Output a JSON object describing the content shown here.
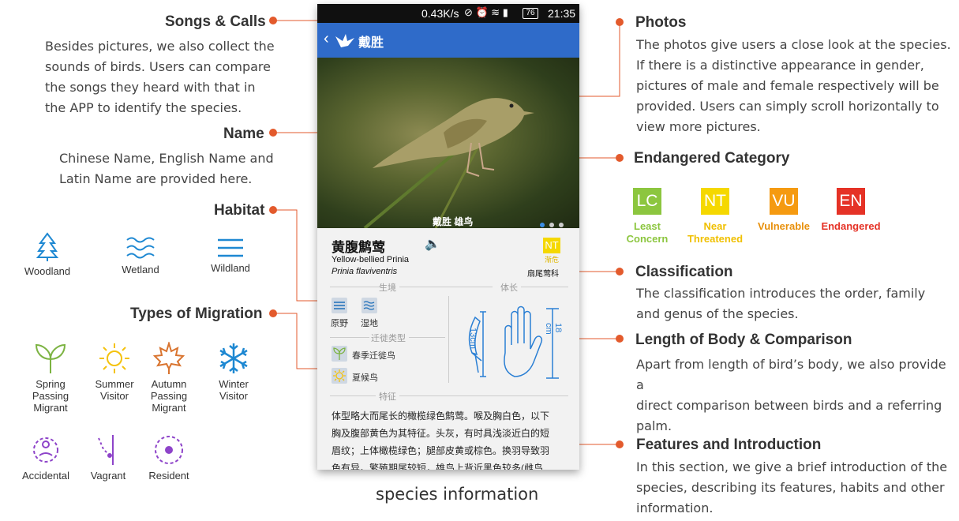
{
  "caption": "species information",
  "left": {
    "songs": {
      "title": "Songs & Calls",
      "lines": [
        "Besides pictures, we also collect the",
        "sounds of birds. Users can compare",
        "the songs they heard with that in",
        "the APP to identify the species."
      ]
    },
    "name": {
      "title": "Name",
      "lines": [
        "Chinese Name, English Name and",
        "Latin Name are provided here."
      ]
    },
    "habitat": {
      "title": "Habitat",
      "items": [
        {
          "label": "Woodland",
          "icon": "tree-icon"
        },
        {
          "label": "Wetland",
          "icon": "waves-icon"
        },
        {
          "label": "Wildland",
          "icon": "lines-icon"
        }
      ]
    },
    "migration": {
      "title": "Types of Migration",
      "items": [
        {
          "label": [
            "Spring",
            "Passing",
            "Migrant"
          ],
          "icon": "sprout-icon",
          "color": "#7cb342"
        },
        {
          "label": [
            "Summer",
            "Visitor"
          ],
          "icon": "sun-icon",
          "color": "#f4c20d"
        },
        {
          "label": [
            "Autumn",
            "Passing",
            "Migrant"
          ],
          "icon": "maple-leaf-icon",
          "color": "#d9742f"
        },
        {
          "label": [
            "Winter",
            "Visitor"
          ],
          "icon": "snowflake-icon",
          "color": "#1e88d2"
        },
        {
          "label": [
            "Accidental"
          ],
          "icon": "accidental-icon",
          "color": "#8e44c9"
        },
        {
          "label": [
            "Vagrant"
          ],
          "icon": "vagrant-icon",
          "color": "#8e44c9"
        },
        {
          "label": [
            "Resident"
          ],
          "icon": "resident-icon",
          "color": "#8e44c9"
        }
      ]
    }
  },
  "right": {
    "photos": {
      "title": "Photos",
      "lines": [
        "The photos give users a close look at the species.",
        "If there is a distinctive appearance in gender,",
        "pictures of male and female respectively will be",
        "provided. Users can simply scroll horizontally to",
        "view more pictures."
      ]
    },
    "endangered": {
      "title": "Endangered Category",
      "badges": [
        {
          "code": "LC",
          "label": [
            "Least",
            "Concern"
          ],
          "color": "#8cc63f"
        },
        {
          "code": "NT",
          "label": [
            "Near",
            "Threatened"
          ],
          "color": "#f5d800"
        },
        {
          "code": "VU",
          "label": [
            "Vulnerable"
          ],
          "color": "#f59a10"
        },
        {
          "code": "EN",
          "label": [
            "Endangered"
          ],
          "color": "#e53226"
        }
      ]
    },
    "classification": {
      "title": "Classification",
      "lines": [
        "The classification introduces the order, family",
        "and genus of the species."
      ]
    },
    "length": {
      "title": "Length of Body & Comparison",
      "lines": [
        "Apart from length of bird’s body, we also provide a",
        "direct comparison between birds and a referring",
        "palm."
      ]
    },
    "features": {
      "title": "Features and Introduction",
      "lines": [
        "In this section, we give a brief introduction of the",
        "species, describing its features, habits and other",
        "information."
      ]
    }
  },
  "phone": {
    "status": {
      "speed": "0.43K/s",
      "battery": "76",
      "time": "21:35"
    },
    "appbar": {
      "title": "戴胜"
    },
    "photo_caption": "戴胜  雄鸟",
    "name_cn": "黄腹鹪莺",
    "name_en": "Yellow-bellied Prinia",
    "name_latin": "Prinia flaviventris",
    "status_code": "NT",
    "status_cn": "渐危",
    "family": "扇尾莺科",
    "habitat_header": "生境",
    "length_header": "体长",
    "habitats": [
      "原野",
      "湿地"
    ],
    "migration_header": "迁徙类型",
    "migrations": [
      "春季迁徙鸟",
      "夏候鸟"
    ],
    "bird_len": "13cm",
    "palm_len": "18 cm",
    "features_header": "特征",
    "features_text": [
      "体型略大而尾长的橄榄绿色鹪莺。喉及胸白色，以下",
      "胸及腹部黄色为其特征。头灰，有时具浅淡近白的短",
      "眉纹；上体橄榄绿色；腿部皮黄或棕色。换羽导致羽",
      "色有异。繁殖期尾较短，雄鸟上背近黑色较多(雌鸟"
    ]
  }
}
